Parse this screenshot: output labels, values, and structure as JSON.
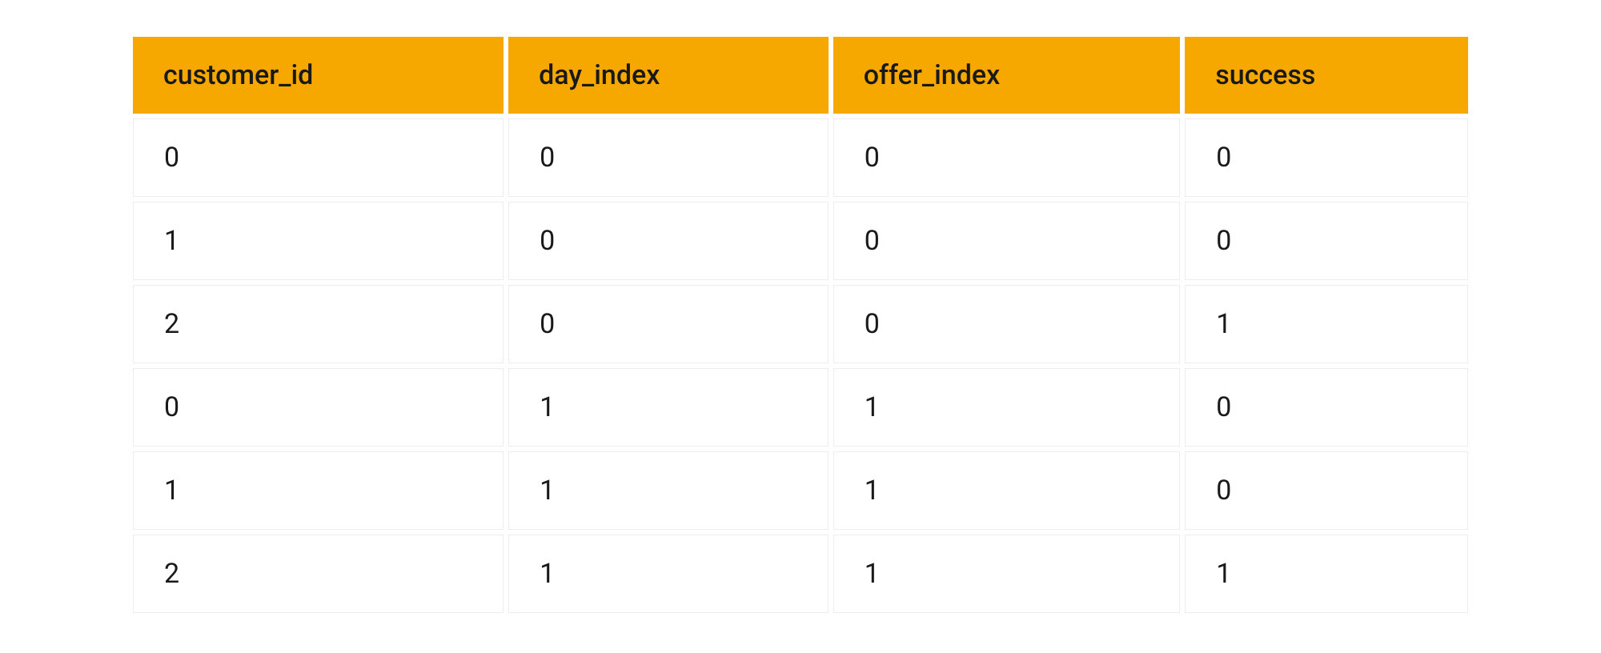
{
  "table": {
    "headers": [
      "customer_id",
      "day_index",
      "offer_index",
      "success"
    ],
    "rows": [
      [
        "0",
        "0",
        "0",
        "0"
      ],
      [
        "1",
        "0",
        "0",
        "0"
      ],
      [
        "2",
        "0",
        "0",
        "1"
      ],
      [
        "0",
        "1",
        "1",
        "0"
      ],
      [
        "1",
        "1",
        "1",
        "0"
      ],
      [
        "2",
        "1",
        "1",
        "1"
      ]
    ]
  }
}
